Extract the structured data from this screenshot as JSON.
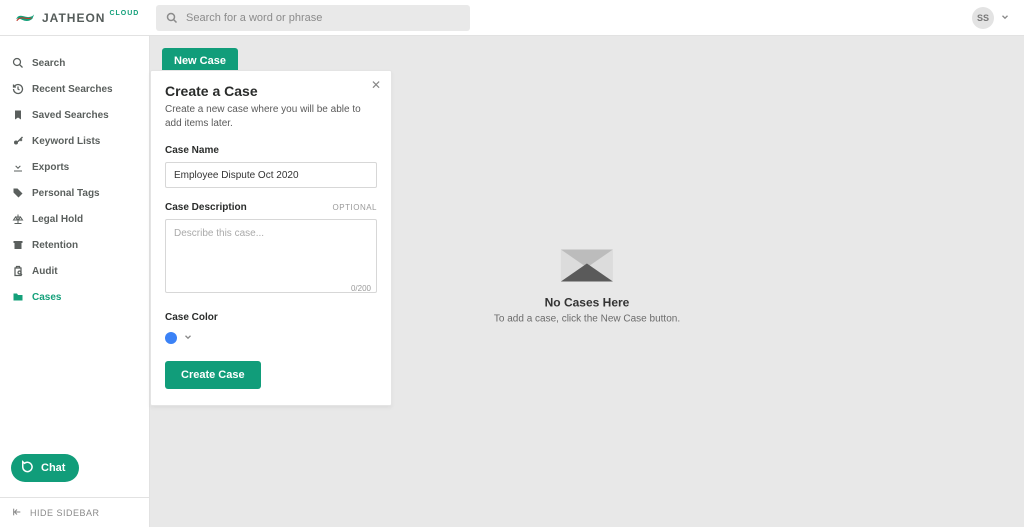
{
  "search": {
    "placeholder": "Search for a word or phrase"
  },
  "user": {
    "initials": "SS"
  },
  "sidebar": {
    "items": [
      {
        "icon": "search-icon",
        "label": "Search"
      },
      {
        "icon": "history-icon",
        "label": "Recent Searches"
      },
      {
        "icon": "bookmark-icon",
        "label": "Saved Searches"
      },
      {
        "icon": "key-icon",
        "label": "Keyword Lists"
      },
      {
        "icon": "download-icon",
        "label": "Exports"
      },
      {
        "icon": "tag-icon",
        "label": "Personal Tags"
      },
      {
        "icon": "scales-icon",
        "label": "Legal Hold"
      },
      {
        "icon": "archive-icon",
        "label": "Retention"
      },
      {
        "icon": "audit-icon",
        "label": "Audit"
      },
      {
        "icon": "folder-icon",
        "label": "Cases"
      }
    ],
    "chat_label": "Chat",
    "hide_label": "HIDE SIDEBAR"
  },
  "main": {
    "new_case_label": "New Case",
    "empty_title": "No Cases Here",
    "empty_subtitle": "To add a case, click the New Case button."
  },
  "modal": {
    "title": "Create a Case",
    "subtitle": "Create a new case where you will be able to add items later.",
    "case_name_label": "Case Name",
    "case_name_value": "Employee Dispute Oct 2020",
    "case_desc_label": "Case Description",
    "optional": "OPTIONAL",
    "desc_placeholder": "Describe this case...",
    "char_count": "0/200",
    "case_color_label": "Case Color",
    "selected_color": "#3b82f6",
    "create_button": "Create Case"
  }
}
